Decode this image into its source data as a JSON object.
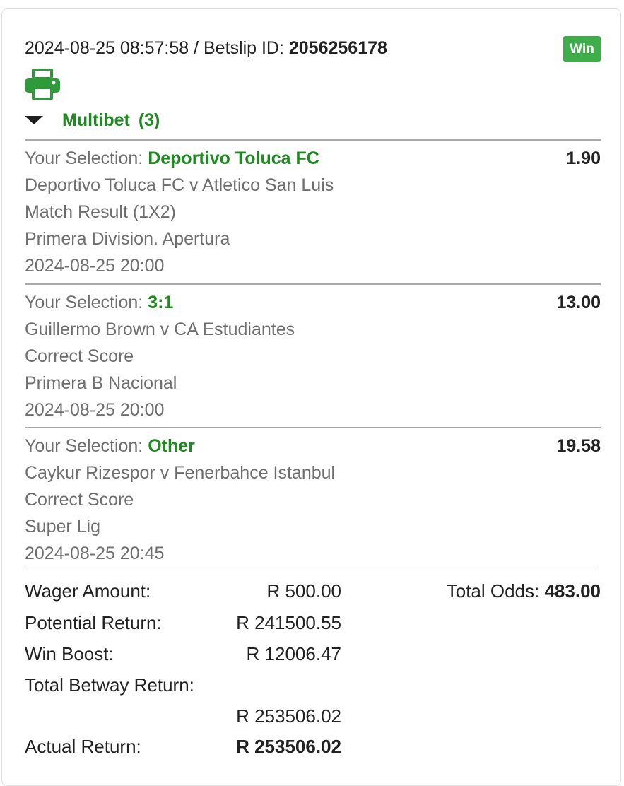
{
  "header": {
    "datetime": "2024-08-25 08:57:58",
    "betslip_prefix": " / Betslip ID: ",
    "betslip_id": "2056256178",
    "status_badge": "Win",
    "print_icon": "printer-icon"
  },
  "multibet": {
    "label": "Multibet",
    "count": "(3)"
  },
  "selection_prefix": "Your Selection: ",
  "selections": [
    {
      "pick": "Deportivo Toluca FC",
      "odds": "1.90",
      "match": "Deportivo Toluca FC v Atletico San Luis",
      "market": "Match Result (1X2)",
      "league": "Primera Division. Apertura",
      "datetime": "2024-08-25 20:00"
    },
    {
      "pick": "3:1",
      "odds": "13.00",
      "match": "Guillermo Brown v CA Estudiantes",
      "market": "Correct Score",
      "league": "Primera B Nacional",
      "datetime": "2024-08-25 20:00"
    },
    {
      "pick": "Other",
      "odds": "19.58",
      "match": "Caykur Rizespor v Fenerbahce Istanbul",
      "market": "Correct Score",
      "league": "Super Lig",
      "datetime": "2024-08-25 20:45"
    }
  ],
  "summary": {
    "wager_label": "Wager Amount:",
    "wager_value": "R 500.00",
    "total_odds_label": "Total Odds: ",
    "total_odds_value": "483.00",
    "potential_label": "Potential Return:",
    "potential_value": "R 241500.55",
    "boost_label": "Win Boost:",
    "boost_value": "R 12006.47",
    "total_betway_label": "Total Betway Return:",
    "total_betway_value": "R 253506.02",
    "actual_label": "Actual Return:",
    "actual_value": "R 253506.02"
  },
  "colors": {
    "accent_green": "#1f8a1f",
    "badge_green": "#3fae4a"
  }
}
